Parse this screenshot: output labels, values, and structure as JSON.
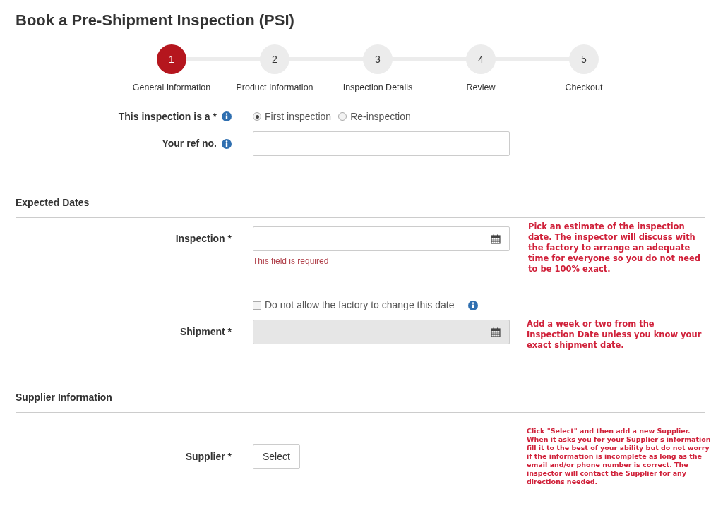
{
  "title": "Book a Pre-Shipment Inspection (PSI)",
  "steps": [
    {
      "number": "1",
      "label": "General Information",
      "selected": true
    },
    {
      "number": "2",
      "label": "Product Information",
      "selected": false
    },
    {
      "number": "3",
      "label": "Inspection Details",
      "selected": false
    },
    {
      "number": "4",
      "label": "Review",
      "selected": false
    },
    {
      "number": "5",
      "label": "Checkout",
      "selected": false
    }
  ],
  "inspection_type": {
    "label": "This inspection is a *",
    "options": [
      {
        "label": "First inspection",
        "selected": true
      },
      {
        "label": "Re-inspection",
        "selected": false
      }
    ]
  },
  "ref_no": {
    "label": "Your ref no."
  },
  "expected_dates": {
    "heading": "Expected Dates",
    "inspection": {
      "label": "Inspection *",
      "error": "This field is required",
      "disabled": false,
      "note": "Pick an estimate of the inspection date. The inspector will discuss with the factory to arrange an adequate time for everyone so you do not need to be 100% exact."
    },
    "lock_date": {
      "label": "Do not allow the factory to change this date",
      "checked": false
    },
    "shipment": {
      "label": "Shipment *",
      "disabled": true,
      "note": "Add a week or two from the Inspection Date unless you know your exact shipment date."
    }
  },
  "supplier_information": {
    "heading": "Supplier Information",
    "supplier": {
      "label": "Supplier *",
      "button": "Select",
      "note": "Click \"Select\" and then add a new Supplier. When it asks you for your Supplier's information fill it to the best of your ability but do not worry if the information is incomplete as long as the email and/or phone number is correct. The inspector will contact the Supplier for any directions needed."
    }
  }
}
